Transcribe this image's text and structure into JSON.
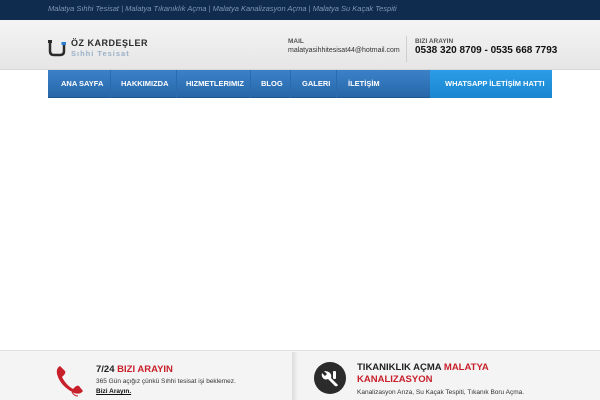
{
  "topbar": {
    "text": "Malatya Sıhhi Tesisat | Malatya Tıkanıklık Açma | Malatya Kanalizasyon Açma | Malatya Su Kaçak Tespiti"
  },
  "header": {
    "logo_title": "ÖZ KARDEŞLER",
    "logo_subtitle": "Sıhhi Tesisat",
    "logo_icon": "pipe-logo-icon",
    "mail_label": "MAIL",
    "mail_value": "malatyasihhitesisat44@hotmail.com",
    "call_label": "BIZI ARAYIN",
    "call_value": "0538 320 8709 - 0535 668 7793"
  },
  "nav": {
    "items": [
      {
        "label": "ANA SAYFA"
      },
      {
        "label": "HAKKIMIZDA"
      },
      {
        "label": "HIZMETLERIMIZ"
      },
      {
        "label": "BLOG"
      },
      {
        "label": "GALERI"
      },
      {
        "label": "İLETİŞİM"
      }
    ],
    "whatsapp_label": "WHATSAPP İLETİŞİM HATTI"
  },
  "bottom": {
    "call_box": {
      "icon": "phone-icon",
      "title_dark": "7/24",
      "title_red": "BIZI ARAYIN",
      "text": "365 Gün açığız çünkü Sıhhi tesisat işi beklemez.",
      "link": "Bizi Arayın."
    },
    "service_box": {
      "icon": "wrench-icon",
      "title_dark": "TIKANIKLIK AÇMA",
      "title_red_1": "MALATYA",
      "title_red_2": "KANALIZASYON",
      "text": "Kanalizasyon Arıza, Su Kaçak Tespiti, Tıkanık Boru Açma."
    }
  },
  "colors": {
    "topbar_bg": "#0f2b4d",
    "nav_bg": "#2f73b8",
    "whatsapp_bg": "#1f8fdb",
    "accent_red": "#c8202b"
  }
}
